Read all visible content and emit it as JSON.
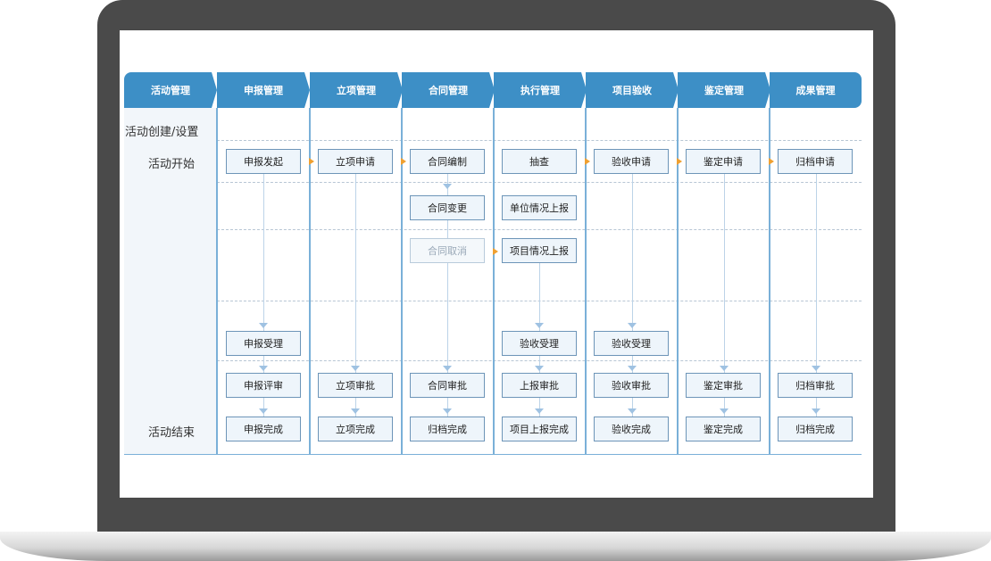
{
  "headers": [
    "活动管理",
    "申报管理",
    "立项管理",
    "合同管理",
    "执行管理",
    "项目验收",
    "鉴定管理",
    "成果管理"
  ],
  "stages": {
    "create": "活动创建/设置",
    "start": "活动开始",
    "end": "活动结束"
  },
  "boxes": {
    "c1": [
      "申报发起",
      "申报受理",
      "申报评审",
      "申报完成"
    ],
    "c2": [
      "立项申请",
      "立项审批",
      "立项完成"
    ],
    "c3": [
      "合同编制",
      "合同变更",
      "合同取消",
      "合同审批",
      "归档完成"
    ],
    "c4": [
      "抽查",
      "单位情况上报",
      "项目情况上报",
      "验收受理",
      "上报审批",
      "项目上报完成"
    ],
    "c5": [
      "验收申请",
      "验收受理",
      "验收审批",
      "验收完成"
    ],
    "c6": [
      "鉴定申请",
      "鉴定审批",
      "鉴定完成"
    ],
    "c7": [
      "归档申请",
      "归档审批",
      "归档完成"
    ]
  }
}
